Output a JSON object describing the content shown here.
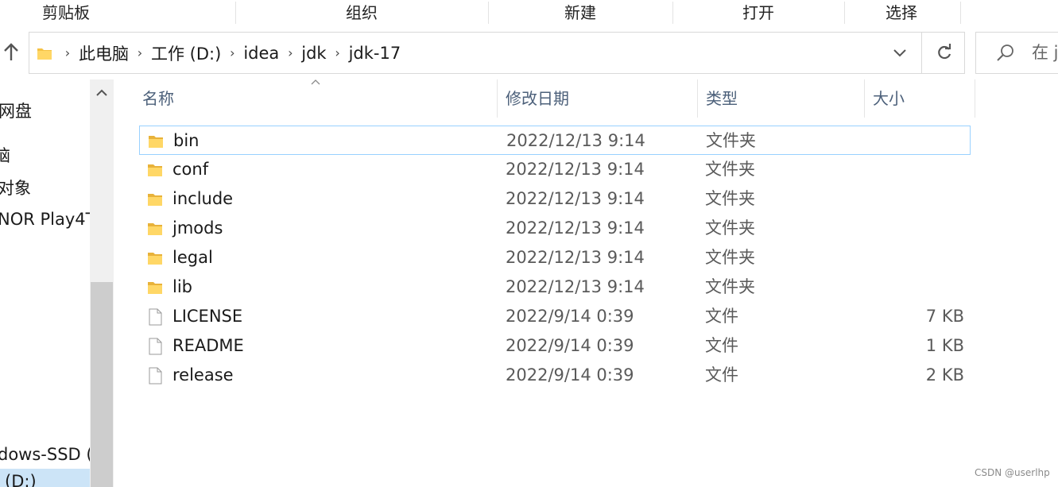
{
  "ribbon": {
    "groups": [
      "剪贴板",
      "组织",
      "新建",
      "打开",
      "选择"
    ]
  },
  "address": {
    "crumbs": [
      "此电脑",
      "工作 (D:)",
      "idea",
      "jdk",
      "jdk-17"
    ],
    "search_placeholder": "在 j"
  },
  "nav": {
    "items": [
      "网盘",
      "脑",
      "对象",
      "NOR Play4T",
      "",
      "",
      "",
      "",
      "",
      "",
      "dows-SSD (",
      "(D:)"
    ]
  },
  "columns": {
    "name": "名称",
    "date": "修改日期",
    "type": "类型",
    "size": "大小"
  },
  "files": [
    {
      "name": "bin",
      "date": "2022/12/13 9:14",
      "type": "文件夹",
      "size": "",
      "icon": "folder-icon"
    },
    {
      "name": "conf",
      "date": "2022/12/13 9:14",
      "type": "文件夹",
      "size": "",
      "icon": "folder-icon"
    },
    {
      "name": "include",
      "date": "2022/12/13 9:14",
      "type": "文件夹",
      "size": "",
      "icon": "folder-icon"
    },
    {
      "name": "jmods",
      "date": "2022/12/13 9:14",
      "type": "文件夹",
      "size": "",
      "icon": "folder-icon"
    },
    {
      "name": "legal",
      "date": "2022/12/13 9:14",
      "type": "文件夹",
      "size": "",
      "icon": "folder-icon"
    },
    {
      "name": "lib",
      "date": "2022/12/13 9:14",
      "type": "文件夹",
      "size": "",
      "icon": "folder-icon"
    },
    {
      "name": "LICENSE",
      "date": "2022/9/14 0:39",
      "type": "文件",
      "size": "7 KB",
      "icon": "file-icon"
    },
    {
      "name": "README",
      "date": "2022/9/14 0:39",
      "type": "文件",
      "size": "1 KB",
      "icon": "file-icon"
    },
    {
      "name": "release",
      "date": "2022/9/14 0:39",
      "type": "文件",
      "size": "2 KB",
      "icon": "file-icon"
    }
  ],
  "watermark": "CSDN @userlhp",
  "colors": {
    "folder": "#f5c244",
    "selection_border": "#99d1ff",
    "header_text": "#4c607a"
  }
}
